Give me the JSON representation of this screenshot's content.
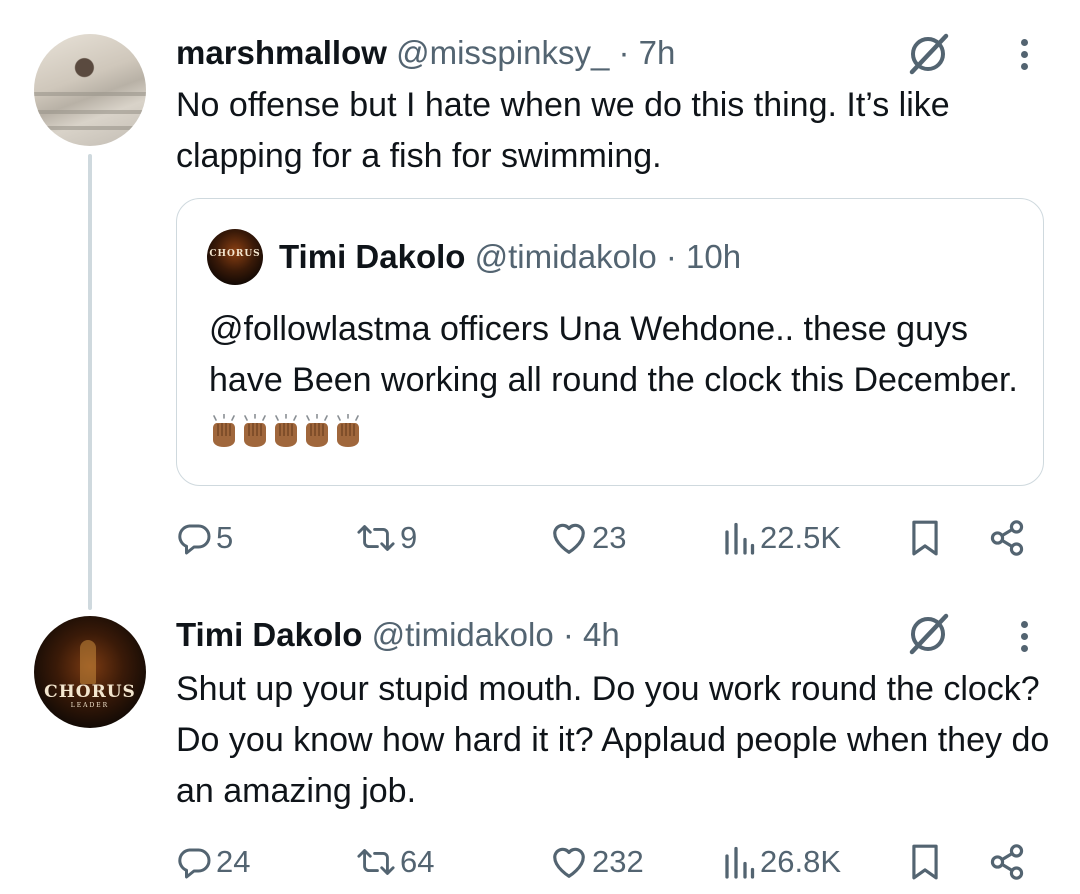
{
  "tweet1": {
    "name": "marshmallow",
    "handle": "@misspinksy_",
    "separator": " · ",
    "time": "7h",
    "text": "No offense but I hate when we do this thing. It’s like clapping for a fish for swimming.",
    "quote": {
      "name": "Timi Dakolo",
      "handle": "@timidakolo",
      "separator": " · ",
      "time": "10h",
      "avatar_label": "CHORUS",
      "text": "@followlastma officers Una Wehdone.. these guys have Been working all round the clock this December.",
      "emoji": [
        "clapping-hands-medium-dark-skin",
        "clapping-hands-medium-dark-skin",
        "clapping-hands-medium-dark-skin",
        "clapping-hands-medium-dark-skin",
        "clapping-hands-medium-dark-skin"
      ]
    },
    "actions": {
      "replies": "5",
      "reposts": "9",
      "likes": "23",
      "views": "22.5K"
    }
  },
  "tweet2": {
    "name": "Timi Dakolo",
    "handle": "@timidakolo",
    "separator": " · ",
    "time": "4h",
    "avatar_label": "CHORUS",
    "avatar_sublabel": "LEADER",
    "text": "Shut  up your stupid mouth. Do you work round the clock? Do you know how hard it it? Applaud people when they do an amazing job.",
    "actions": {
      "replies": "24",
      "reposts": "64",
      "likes": "232",
      "views": "26.8K"
    }
  },
  "colors": {
    "text": "#0f1419",
    "secondary": "#536471",
    "border": "#cfd9de",
    "emoji_skin": "#a0673c"
  }
}
